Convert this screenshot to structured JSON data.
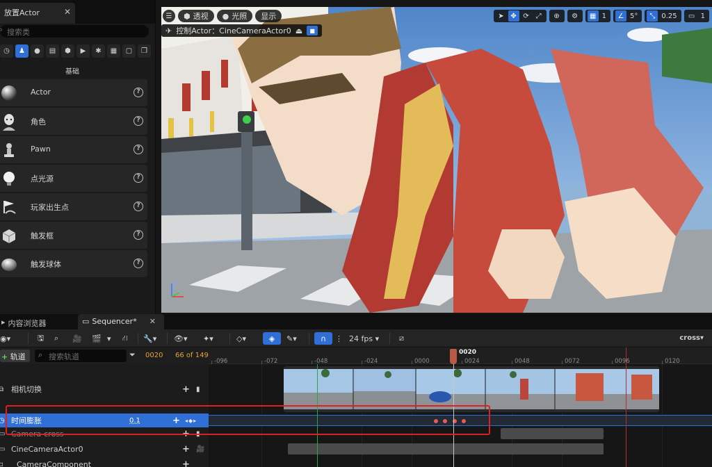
{
  "place_panel": {
    "tab_title": "放置Actor",
    "close_glyph": "✕",
    "search_placeholder": "搜索类",
    "category_icons": [
      "recent-icon",
      "basic-icon",
      "lights-icon",
      "cinematic-icon",
      "visual-effects-icon",
      "geometry-icon",
      "volumes-icon",
      "all-classes-icon",
      "shapes-icon",
      "misc-icon"
    ],
    "category_title": "基础",
    "items": [
      {
        "label": "Actor",
        "icon": "sphere-icon"
      },
      {
        "label": "角色",
        "icon": "character-icon"
      },
      {
        "label": "Pawn",
        "icon": "pawn-icon"
      },
      {
        "label": "点光源",
        "icon": "point-light-icon"
      },
      {
        "label": "玩家出生点",
        "icon": "player-start-icon"
      },
      {
        "label": "触发框",
        "icon": "trigger-box-icon"
      },
      {
        "label": "触发球体",
        "icon": "trigger-sphere-icon"
      }
    ]
  },
  "viewport": {
    "perspective": "透视",
    "lit": "光照",
    "show": "显示",
    "pilot_label": "控制Actor：CineCameraActor0",
    "grid_value": "1",
    "rotation_snap": "5°",
    "scale_snap": "0.25",
    "camera_speed": "1"
  },
  "bottom_tabs": {
    "content_browser": "内容浏览器",
    "sequencer": "Sequencer*"
  },
  "sequencer": {
    "fps": "24 fps",
    "sequence_name": "cross▾",
    "add_track": "轨道",
    "search_placeholder": "搜索轨道",
    "current_frame": "0020",
    "frame_count": "66 of 149",
    "playhead_label": "0020",
    "tracks": [
      {
        "label": "相机切换",
        "icon": "camera-cut-icon"
      },
      {
        "label": "时间膨胀",
        "value": "0.1",
        "icon": "time-dilation-icon",
        "selected": true
      },
      {
        "label": "Camera-cross",
        "icon": "camera-icon",
        "muted": true
      },
      {
        "label": "CineCameraActor0",
        "icon": "camera-icon"
      },
      {
        "label": "CameraComponent",
        "icon": "component-icon"
      }
    ],
    "ruler_labels": [
      "-096",
      "-072",
      "-048",
      "-024",
      "0000",
      "0024",
      "0048",
      "0072",
      "0096",
      "0120"
    ]
  },
  "colors": {
    "accent": "#2f6fd6",
    "frame_text": "#e8a33a",
    "key": "#e85a5a",
    "annotation": "#e02020"
  }
}
